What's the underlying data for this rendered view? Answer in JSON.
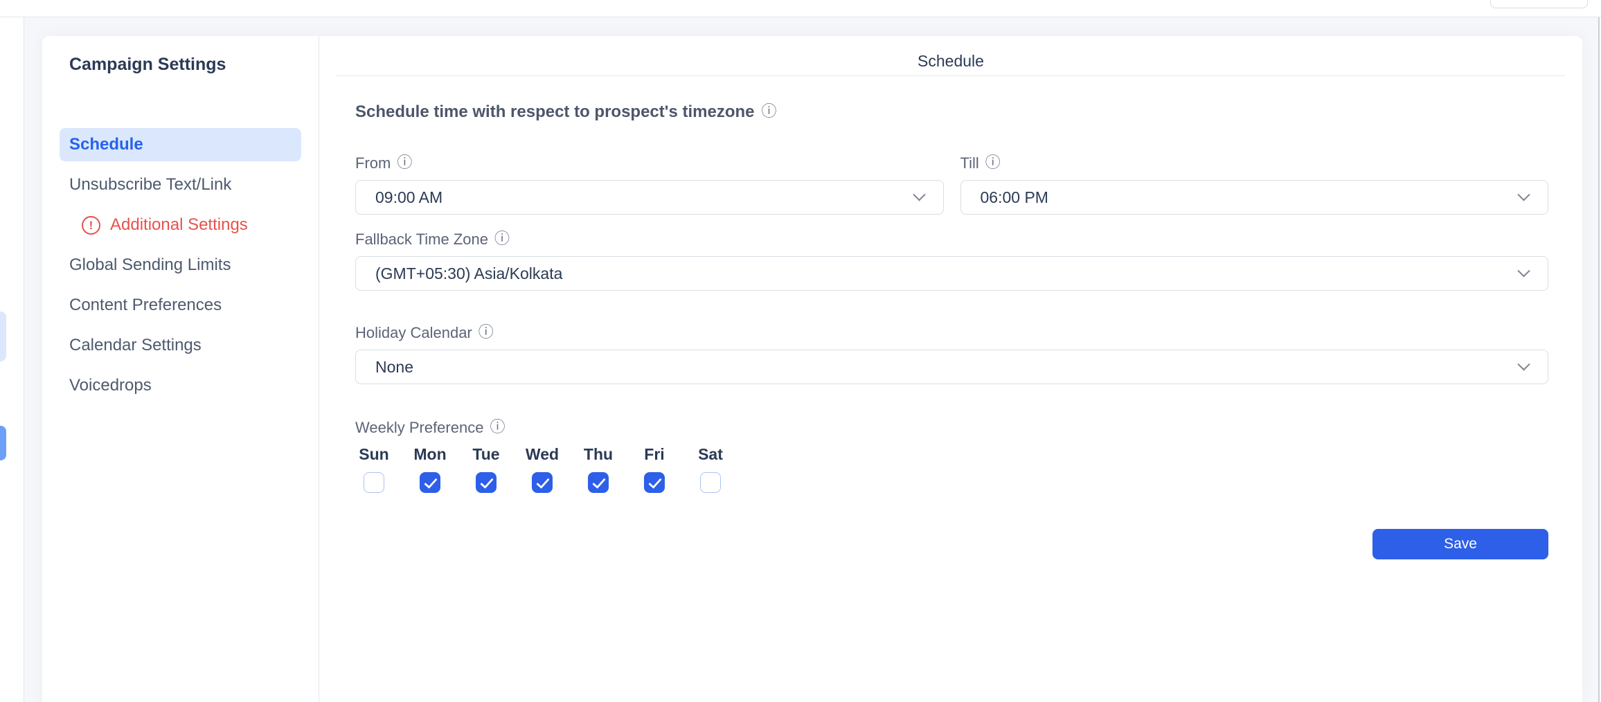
{
  "sidebar": {
    "title": "Campaign Settings",
    "items": [
      {
        "label": "Schedule",
        "selected": true,
        "alert": false
      },
      {
        "label": "Unsubscribe Text/Link",
        "selected": false,
        "alert": false
      },
      {
        "label": "Additional Settings",
        "selected": false,
        "alert": true
      },
      {
        "label": "Global Sending Limits",
        "selected": false,
        "alert": false
      },
      {
        "label": "Content Preferences",
        "selected": false,
        "alert": false
      },
      {
        "label": "Calendar Settings",
        "selected": false,
        "alert": false
      },
      {
        "label": "Voicedrops",
        "selected": false,
        "alert": false
      }
    ],
    "alert_icon": "exclamation-circle-icon",
    "alert_glyph": "!"
  },
  "content": {
    "title": "Schedule",
    "section_heading": "Schedule time with respect to prospect's timezone",
    "info_icon_glyph": "ⓘ",
    "fields": {
      "from": {
        "label": "From",
        "value": "09:00 AM"
      },
      "till": {
        "label": "Till",
        "value": "06:00 PM"
      },
      "fallback_timezone": {
        "label": "Fallback Time Zone",
        "value": "(GMT+05:30) Asia/Kolkata"
      },
      "holiday_calendar": {
        "label": "Holiday Calendar",
        "value": "None"
      }
    },
    "weekly_preference": {
      "label": "Weekly Preference",
      "days": [
        {
          "label": "Sun",
          "checked": false
        },
        {
          "label": "Mon",
          "checked": true
        },
        {
          "label": "Tue",
          "checked": true
        },
        {
          "label": "Wed",
          "checked": true
        },
        {
          "label": "Thu",
          "checked": true
        },
        {
          "label": "Fri",
          "checked": true
        },
        {
          "label": "Sat",
          "checked": false
        }
      ]
    },
    "save_label": "Save"
  },
  "colors": {
    "primary_blue": "#2d5fe8",
    "selected_text_blue": "#2563eb",
    "selected_bg_blue": "#dbe7fd",
    "alert_red": "#e8514d",
    "dark_navy_text": "#2b3a55",
    "label_gray": "#5b6477",
    "page_background": "#f6f7fa",
    "rail_pill_blue": "#6d9ff8"
  }
}
